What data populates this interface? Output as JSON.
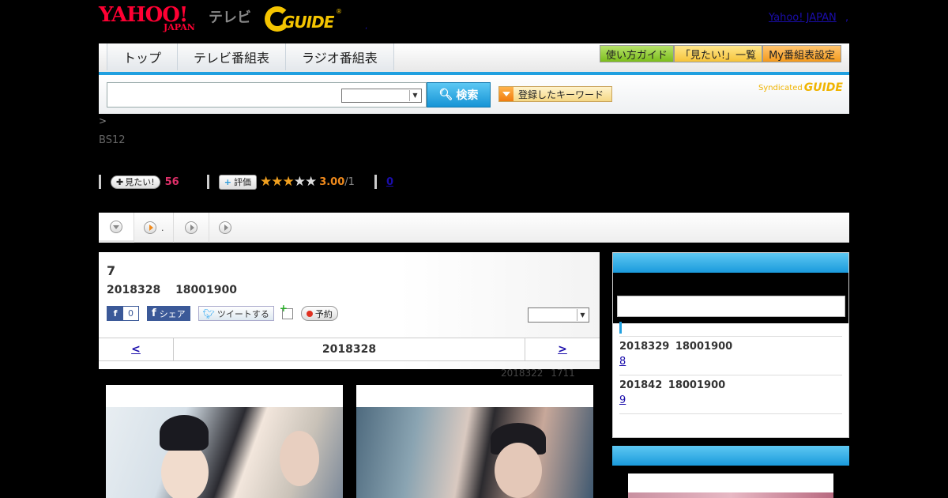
{
  "header": {
    "yahoo_logo": "YAHOO!",
    "yahoo_logo_sub": "JAPAN",
    "tv_label": "テレビ",
    "gguide_logo": "GUIDE",
    "gguide_mark": "®",
    "header_dot": ",",
    "yahoo_japan_link": "Yahoo! JAPAN",
    "yahoo_japan_link_dot": ","
  },
  "nav": {
    "tabs": [
      {
        "label": "トップ"
      },
      {
        "label": "テレビ番組表"
      },
      {
        "label": "ラジオ番組表"
      }
    ],
    "right_buttons": [
      {
        "label": "使い方ガイド"
      },
      {
        "label": "「見たい!」一覧"
      },
      {
        "label": "My番組表設定"
      }
    ]
  },
  "search": {
    "placeholder": "",
    "button_label": "検索",
    "keyword_button_label": "登録したキーワード",
    "syndicated_label": "Syndicated",
    "syndicated_logo": "GUIDE"
  },
  "breadcrumb": ">",
  "channel": "BS12",
  "stats": {
    "mitai_label": "見たい!",
    "mitai_count": "56",
    "hyoka_label": "評価",
    "rating": 3,
    "rating_max": 5,
    "score": "3.00",
    "score_of": "/1",
    "comments_count": "0"
  },
  "tabstrip": {
    "tab2_label": "."
  },
  "program": {
    "title": "7",
    "date_line": "2018328 18001900",
    "fb_like_count": "0",
    "fb_share_label": "シェア",
    "tweet_label": "ツイートする",
    "yoyaku_label": "予約",
    "date_nav": {
      "prev": "<",
      "current": "2018328",
      "next": ">"
    },
    "updated": "2018322 1711"
  },
  "sidebar": {
    "items": [
      {
        "date": "2018329 18001900",
        "link": "8"
      },
      {
        "date": "201842 18001900",
        "link": "9"
      }
    ]
  },
  "colors": {
    "accent_blue": "#20a0e0",
    "yahoo_red": "#ff0033",
    "gguide_yellow": "#f4c400",
    "mitai_pink": "#e0306a"
  }
}
